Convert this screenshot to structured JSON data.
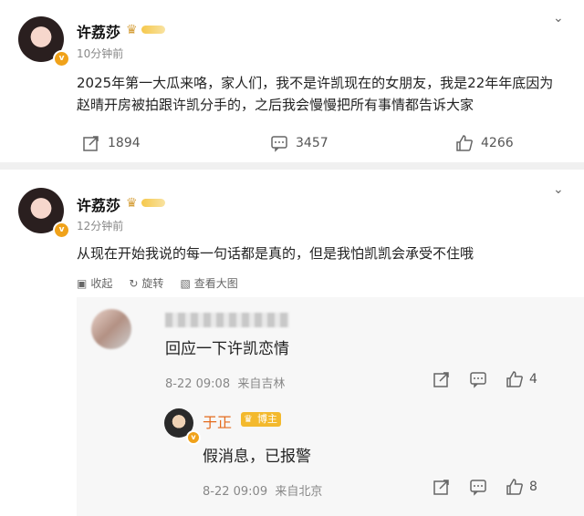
{
  "post1": {
    "username": "许荔莎",
    "time": "10分钟前",
    "content": "2025年第一大瓜来咯，家人们，我不是许凯现在的女朋友，我是22年年底因为赵晴开房被拍跟许凯分手的，之后我会慢慢把所有事情都告诉大家",
    "shares": "1894",
    "comments": "3457",
    "likes": "4266"
  },
  "post2": {
    "username": "许荔莎",
    "time": "12分钟前",
    "content": "从现在开始我说的每一句话都是真的，但是我怕凯凯会承受不住哦",
    "collapse": "收起",
    "rotate": "旋转",
    "view_large": "查看大图"
  },
  "comment": {
    "text": "回应一下许凯恋情",
    "date": "8-22 09:08",
    "location": "来自吉林",
    "likes": "4"
  },
  "reply": {
    "username": "于正",
    "badge": "博主",
    "text": "假消息，已报警",
    "date": "8-22 09:09",
    "location": "来自北京",
    "likes": "8"
  },
  "colors": {
    "accent_orange": "#e46b1e",
    "verified": "#f0a21a"
  }
}
